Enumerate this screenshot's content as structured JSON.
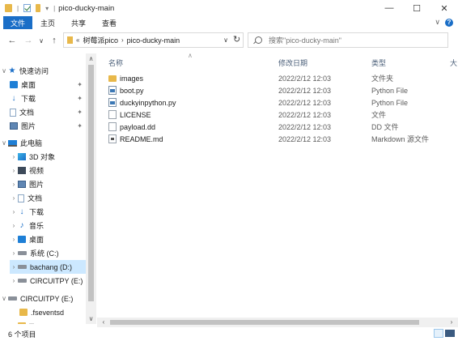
{
  "window": {
    "title": "pico-ducky-main",
    "controls": {
      "minimize": "—",
      "maximize": "☐",
      "close": "✕"
    }
  },
  "ribbon": {
    "tabs": [
      "文件",
      "主页",
      "共享",
      "查看"
    ],
    "collapse_glyph": "∨",
    "help_glyph": "?"
  },
  "navigation": {
    "back": "←",
    "forward": "→",
    "recent": "∨",
    "up": "↑",
    "refresh": "↻"
  },
  "address": {
    "overflow": "«",
    "crumbs": [
      "树莓派pico",
      "pico-ducky-main"
    ],
    "dropdown": "∨"
  },
  "search": {
    "placeholder": "搜索\"pico-ducky-main\""
  },
  "sidebar": {
    "quick_access": "快速访问",
    "quick_items": [
      "桌面",
      "下载",
      "文档",
      "图片"
    ],
    "this_pc": "此电脑",
    "pc_items": [
      "3D 对象",
      "视频",
      "图片",
      "文档",
      "下载",
      "音乐",
      "桌面",
      "系统 (C:)",
      "bachang (D:)",
      "CIRCUITPY (E:)"
    ],
    "drive_root": "CIRCUITPY (E:)",
    "drive_children": [
      ".fseventsd",
      "lib"
    ]
  },
  "columns": {
    "name": "名称",
    "date": "修改日期",
    "type": "类型",
    "size": "大"
  },
  "files": [
    {
      "name": "images",
      "date": "2022/2/12 12:03",
      "type": "文件夹",
      "icon": "folder-icon"
    },
    {
      "name": "boot.py",
      "date": "2022/2/12 12:03",
      "type": "Python File",
      "icon": "python-file-icon"
    },
    {
      "name": "duckyinpython.py",
      "date": "2022/2/12 12:03",
      "type": "Python File",
      "icon": "python-file-icon"
    },
    {
      "name": "LICENSE",
      "date": "2022/2/12 12:03",
      "type": "文件",
      "icon": "file-icon"
    },
    {
      "name": "payload.dd",
      "date": "2022/2/12 12:03",
      "type": "DD 文件",
      "icon": "file-icon"
    },
    {
      "name": "README.md",
      "date": "2022/2/12 12:03",
      "type": "Markdown 源文件",
      "icon": "markdown-file-icon"
    }
  ],
  "status": {
    "item_count": "6 个项目"
  },
  "colors": {
    "accent": "#1a6ec7",
    "selected_bg": "#cce8ff",
    "folder": "#e8b84a"
  }
}
